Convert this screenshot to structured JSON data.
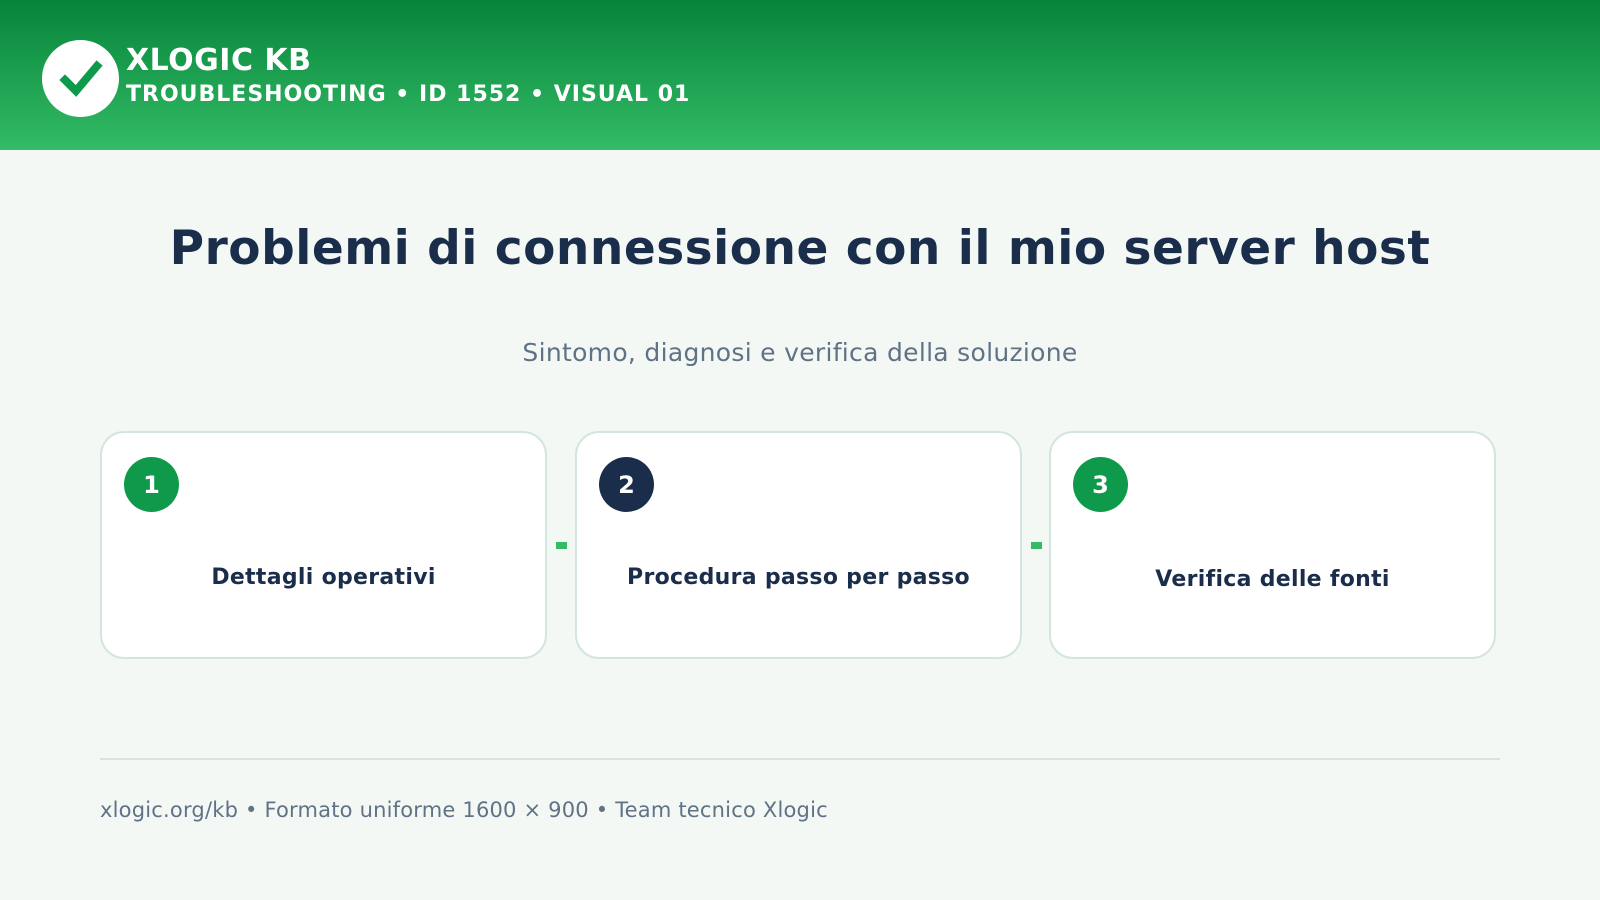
{
  "header": {
    "brand_title": "XLOGIC KB",
    "brand_subtitle": "TROUBLESHOOTING • ID 1552 • VISUAL 01",
    "logo_icon": "checkmark-icon"
  },
  "main": {
    "title": "Problemi di connessione con il mio server host",
    "subtitle": "Sintomo, diagnosi e verifica della soluzione"
  },
  "steps": [
    {
      "number": "1",
      "label": "Dettagli operativi"
    },
    {
      "number": "2",
      "label": "Procedura passo per passo"
    },
    {
      "number": "3",
      "label": "Verifica delle fonti"
    }
  ],
  "footer": {
    "text": "xlogic.org/kb • Formato uniforme 1600 × 900 • Team tecnico Xlogic"
  },
  "colors": {
    "header_top": "#06843a",
    "header_bottom": "#33bb66",
    "accent_green": "#0f9a4b",
    "navy": "#1a2d4a",
    "muted_text": "#5f7286",
    "background": "#f4f8f5",
    "card_border": "#d3e6dc"
  }
}
